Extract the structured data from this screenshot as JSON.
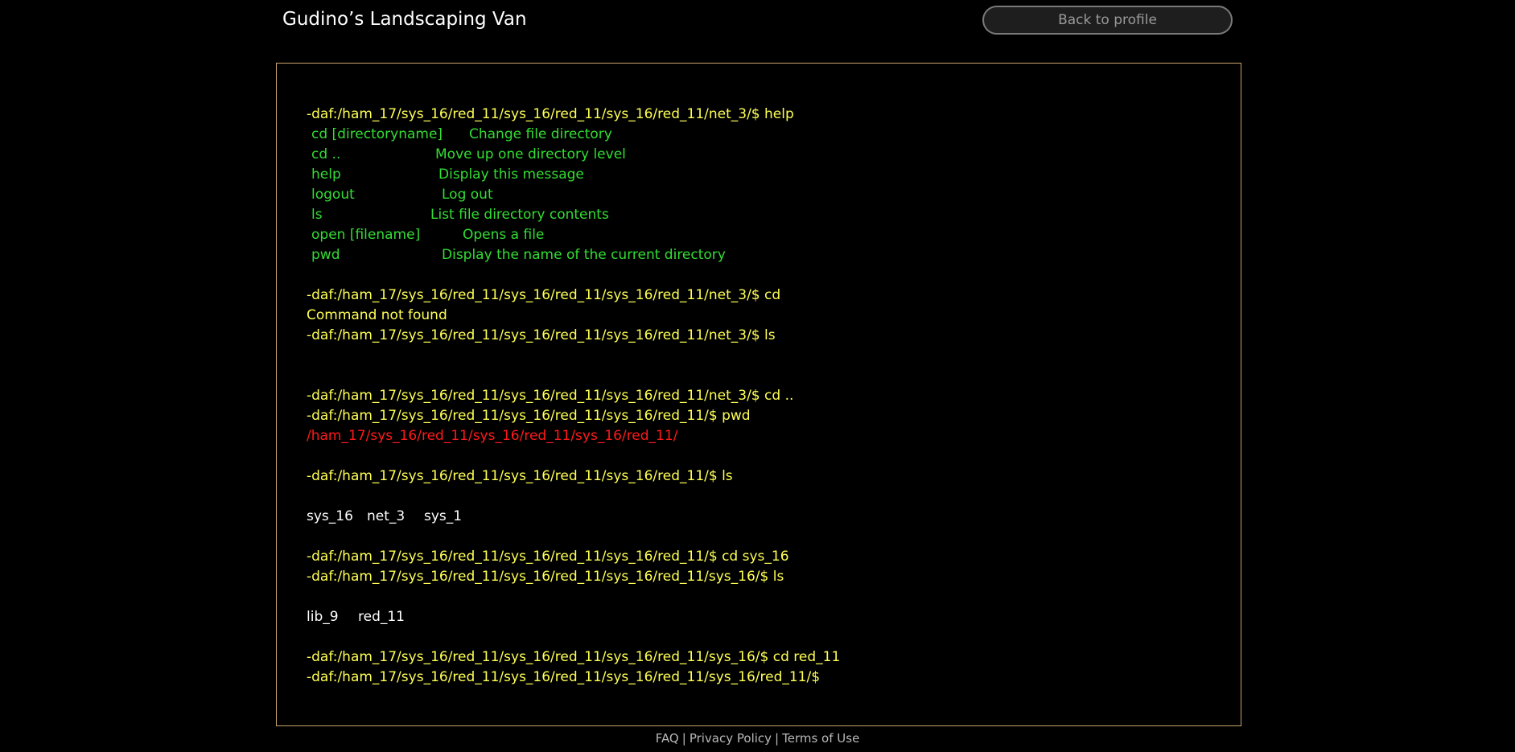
{
  "header": {
    "title": "Gudino’s Landscaping Van",
    "back_button_label": "Back to profile"
  },
  "terminal": {
    "prompt_1": "-daf:/ham_17/sys_16/red_11/sys_16/red_11/sys_16/red_11/net_3/$ help",
    "help": [
      {
        "cmd": "cd [directoryname]",
        "desc": "Change file directory"
      },
      {
        "cmd": "cd ..",
        "desc": "Move up one directory level"
      },
      {
        "cmd": "help",
        "desc": "Display this message"
      },
      {
        "cmd": "logout",
        "desc": "Log out"
      },
      {
        "cmd": "ls",
        "desc": "List file directory contents"
      },
      {
        "cmd": "open [filename]",
        "desc": "Opens a file"
      },
      {
        "cmd": "pwd",
        "desc": "Display the name of the current directory"
      }
    ],
    "prompt_2": "-daf:/ham_17/sys_16/red_11/sys_16/red_11/sys_16/red_11/net_3/$ cd",
    "error_1": "Command not found",
    "prompt_3": "-daf:/ham_17/sys_16/red_11/sys_16/red_11/sys_16/red_11/net_3/$ ls",
    "prompt_4": "-daf:/ham_17/sys_16/red_11/sys_16/red_11/sys_16/red_11/net_3/$ cd ..",
    "prompt_5": "-daf:/ham_17/sys_16/red_11/sys_16/red_11/sys_16/red_11/$ pwd",
    "pwd_output": "/ham_17/sys_16/red_11/sys_16/red_11/sys_16/red_11/",
    "prompt_6": "-daf:/ham_17/sys_16/red_11/sys_16/red_11/sys_16/red_11/$ ls",
    "ls_1": [
      "sys_16",
      "net_3",
      "sys_1"
    ],
    "prompt_7": "-daf:/ham_17/sys_16/red_11/sys_16/red_11/sys_16/red_11/$ cd sys_16",
    "prompt_8": "-daf:/ham_17/sys_16/red_11/sys_16/red_11/sys_16/red_11/sys_16/$ ls",
    "ls_2": [
      "lib_9",
      "red_11"
    ],
    "prompt_9": "-daf:/ham_17/sys_16/red_11/sys_16/red_11/sys_16/red_11/sys_16/$ cd red_11",
    "prompt_10": "-daf:/ham_17/sys_16/red_11/sys_16/red_11/sys_16/red_11/sys_16/red_11/$"
  },
  "footer": {
    "faq": "FAQ",
    "privacy": "Privacy Policy",
    "terms": "Terms of Use",
    "separator": "|"
  },
  "colors": {
    "prompt": "#ffff55",
    "help_text": "#33dd33",
    "path_output": "#ff1a1a",
    "listing": "#ffffff",
    "terminal_border": "#c8a46a"
  }
}
